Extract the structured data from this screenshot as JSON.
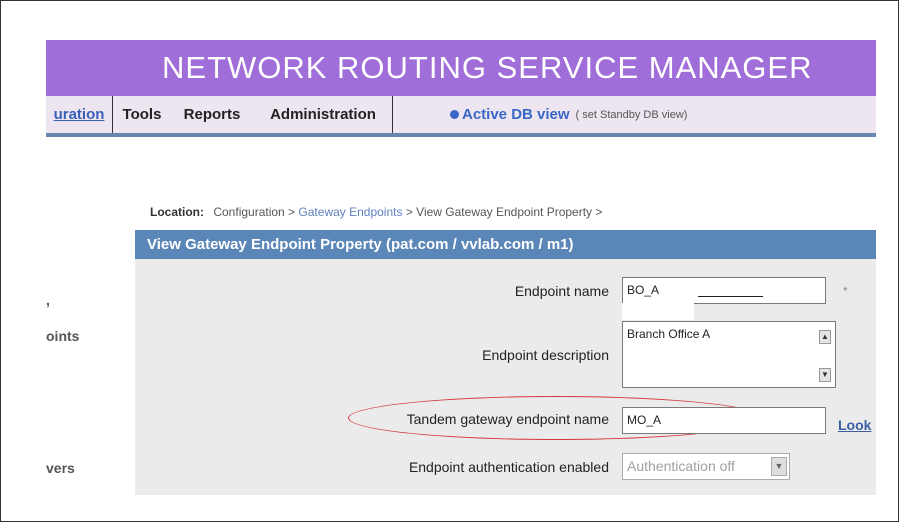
{
  "app": {
    "banner_title": "NETWORK ROUTING SERVICE MANAGER"
  },
  "menu": {
    "tabs": [
      {
        "label": "uration"
      },
      {
        "label": "Tools"
      },
      {
        "label": "Reports"
      },
      {
        "label": "Administration"
      }
    ],
    "db_view_label": "Active DB view",
    "set_standby_label": "( set Standby DB view)"
  },
  "location": {
    "label": "Location:",
    "crumbs": [
      "Configuration >",
      "Gateway Endpoints",
      "> View Gateway Endpoint Property >"
    ]
  },
  "panel": {
    "title": "View Gateway Endpoint Property (pat.com / vvlab.com / m1)"
  },
  "sidebar": {
    "items": [
      ",",
      "oints",
      "vers"
    ]
  },
  "form": {
    "endpoint_name": {
      "label": "Endpoint name",
      "value": "BO_A",
      "required_marker": "*"
    },
    "endpoint_description": {
      "label": "Endpoint description",
      "value": "Branch Office A"
    },
    "tandem_name": {
      "label": "Tandem gateway endpoint name",
      "value": "MO_A",
      "lookup_label": "Look"
    },
    "auth_enabled": {
      "label": "Endpoint authentication enabled",
      "value": "Authentication off"
    }
  },
  "colors": {
    "banner": "#a06ed8",
    "panel_header": "#5b87b8",
    "highlight_oval": "#d6363a",
    "link": "#3a67c7"
  },
  "icons": {
    "scroll_up": "scroll-up-arrow-icon",
    "scroll_down": "scroll-down-arrow-icon",
    "dropdown": "dropdown-arrow-icon",
    "active_dot": "bullet-dot-icon"
  }
}
